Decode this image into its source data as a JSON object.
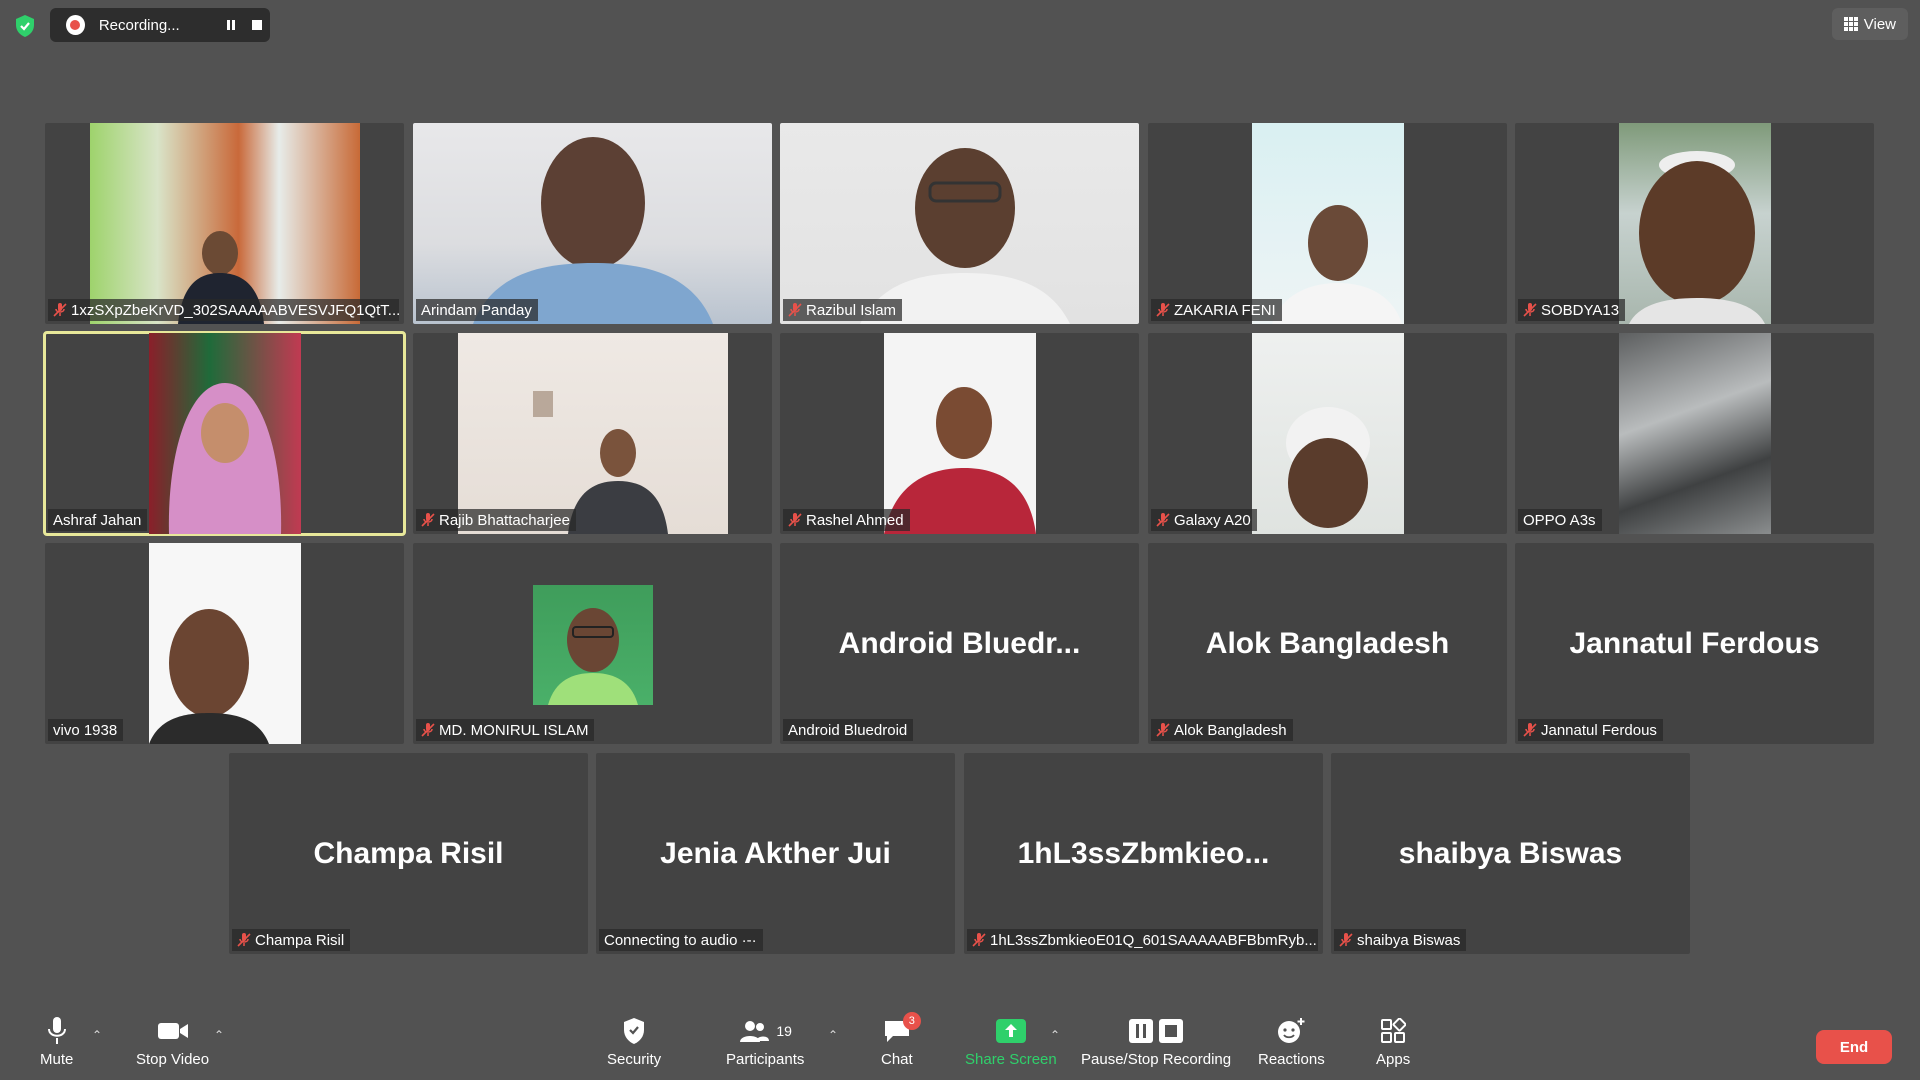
{
  "topbar": {
    "recording_label": "Recording...",
    "view_label": "View"
  },
  "tiles_row1": [
    {
      "name": "1xzSXpZbeKrVD_302SAAAAABVESVJFQ1QtT...",
      "muted": true
    },
    {
      "name": "Arindam Panday",
      "muted": false
    },
    {
      "name": "Razibul Islam",
      "muted": true
    },
    {
      "name": "ZAKARIA FENI",
      "muted": true
    },
    {
      "name": "SOBDYA13",
      "muted": true
    }
  ],
  "tiles_row2": [
    {
      "name": "Ashraf Jahan",
      "muted": false,
      "active": true
    },
    {
      "name": "Rajib Bhattacharjee",
      "muted": true
    },
    {
      "name": "Rashel Ahmed",
      "muted": true
    },
    {
      "name": "Galaxy A20",
      "muted": true
    },
    {
      "name": "OPPO A3s",
      "muted": false
    }
  ],
  "tiles_row3": [
    {
      "name": "vivo 1938",
      "muted": false
    },
    {
      "name": "MD. MONIRUL ISLAM",
      "muted": true
    },
    {
      "name": "Android Bluedroid",
      "big": "Android  Bluedr...",
      "muted": false
    },
    {
      "name": "Alok Bangladesh",
      "big": "Alok Bangladesh",
      "muted": true
    },
    {
      "name": "Jannatul Ferdous",
      "big": "Jannatul Ferdous",
      "muted": true
    }
  ],
  "tiles_row4": [
    {
      "name": "Champa Risil",
      "big": "Champa Risil",
      "muted": true
    },
    {
      "name": "Connecting to audio ·-·",
      "big": "Jenia Akther Jui",
      "muted": false
    },
    {
      "name": "1hL3ssZbmkieoE01Q_601SAAAAABFBbmRyb...",
      "big": "1hL3ssZbmkieo...",
      "muted": true
    },
    {
      "name": "shaibya Biswas",
      "big": "shaibya Biswas",
      "muted": true
    }
  ],
  "toolbar": {
    "mute": "Mute",
    "stop_video": "Stop Video",
    "security": "Security",
    "participants": "Participants",
    "participants_count": "19",
    "chat": "Chat",
    "chat_badge": "3",
    "share_screen": "Share Screen",
    "pause_stop": "Pause/Stop Recording",
    "reactions": "Reactions",
    "apps": "Apps",
    "end": "End"
  },
  "colors": {
    "background": "#525252",
    "tile": "#434343",
    "share_green": "#2fd06b",
    "end_red": "#e8514a",
    "active_outline": "#e8e89a"
  }
}
